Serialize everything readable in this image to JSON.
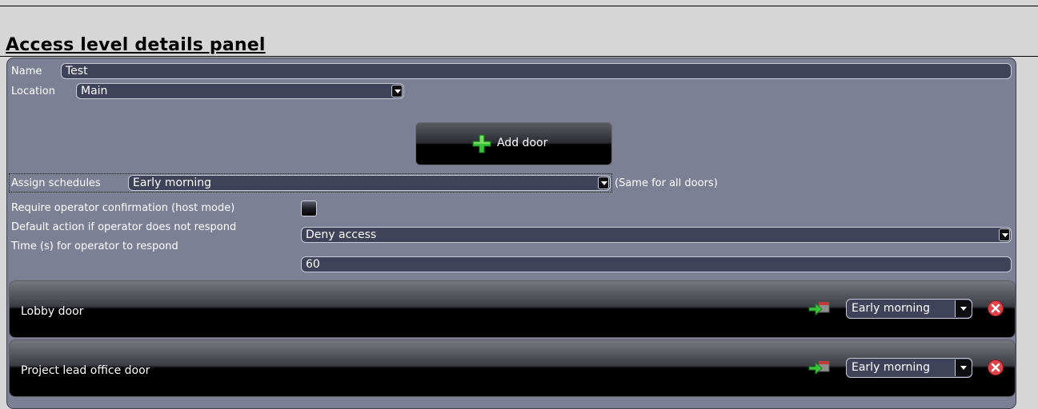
{
  "panel": {
    "title": "Access level details panel"
  },
  "form": {
    "name_label": "Name",
    "name_value": "Test",
    "location_label": "Location",
    "location_value": "Main",
    "add_door_label": "Add door",
    "assign_schedules_label": "Assign schedules",
    "assign_schedules_value": "Early morning",
    "assign_schedules_note": "(Same for all doors)",
    "require_confirmation_label": "Require operator confirmation (host mode)",
    "require_confirmation_checked": false,
    "default_action_label": "Default action if operator does not respond",
    "default_action_value": "Deny access",
    "response_time_label": "Time (s) for operator to respond",
    "response_time_value": "60"
  },
  "doors": [
    {
      "name": "Lobby door",
      "schedule": "Early morning"
    },
    {
      "name": "Project lead office door",
      "schedule": "Early morning"
    }
  ],
  "icons": {
    "add": "plus-icon",
    "apply_schedule": "apply-schedule-icon",
    "remove": "remove-icon",
    "dropdown": "chevron-down-icon"
  },
  "colors": {
    "panel_bg": "#7d8095",
    "field_bg": "#3f4258",
    "accent_green": "#37c33a",
    "remove_red": "#e2434b"
  }
}
